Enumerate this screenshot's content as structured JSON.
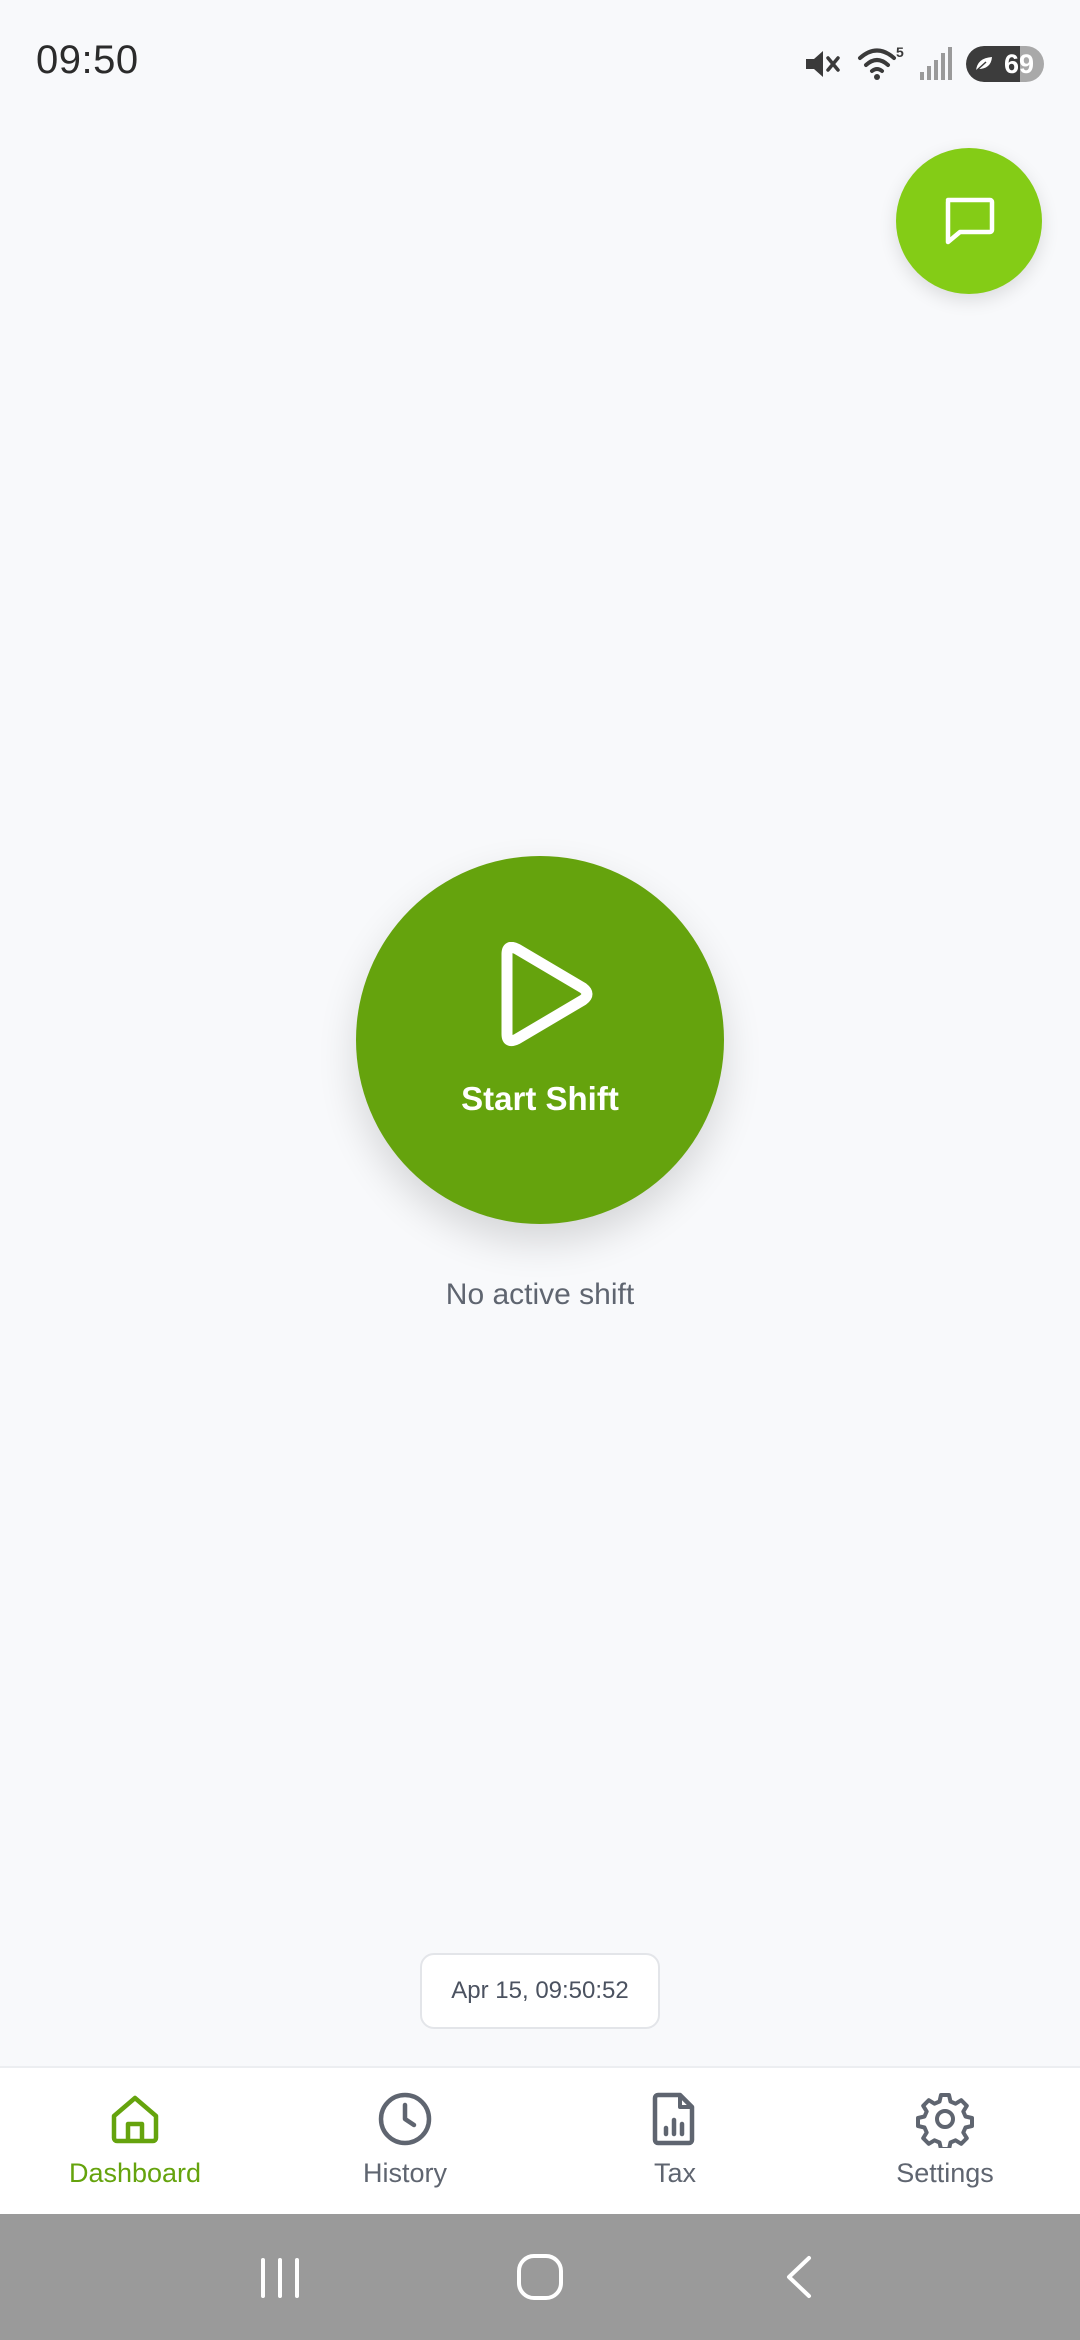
{
  "status_bar": {
    "time": "09:50",
    "battery_level": "69",
    "battery_fraction": 0.69,
    "wifi_badge": "5",
    "icons": [
      "mute-icon",
      "wifi-icon",
      "signal-icon",
      "battery-icon"
    ]
  },
  "colors": {
    "primary": "#65a30d",
    "fab": "#84cc16",
    "background": "#f8f9fb",
    "muted_text": "#5f6570"
  },
  "chat": {
    "icon": "chat-icon"
  },
  "main": {
    "start_button_label": "Start Shift",
    "start_icon": "play-icon",
    "status_text": "No active shift"
  },
  "timestamp": "Apr 15, 09:50:52",
  "bottom_nav": {
    "items": [
      {
        "label": "Dashboard",
        "icon": "home-icon",
        "active": true
      },
      {
        "label": "History",
        "icon": "clock-icon",
        "active": false
      },
      {
        "label": "Tax",
        "icon": "report-icon",
        "active": false
      },
      {
        "label": "Settings",
        "icon": "gear-icon",
        "active": false
      }
    ]
  },
  "system_nav": {
    "buttons": [
      "recents-icon",
      "home-circle-icon",
      "back-icon"
    ]
  }
}
